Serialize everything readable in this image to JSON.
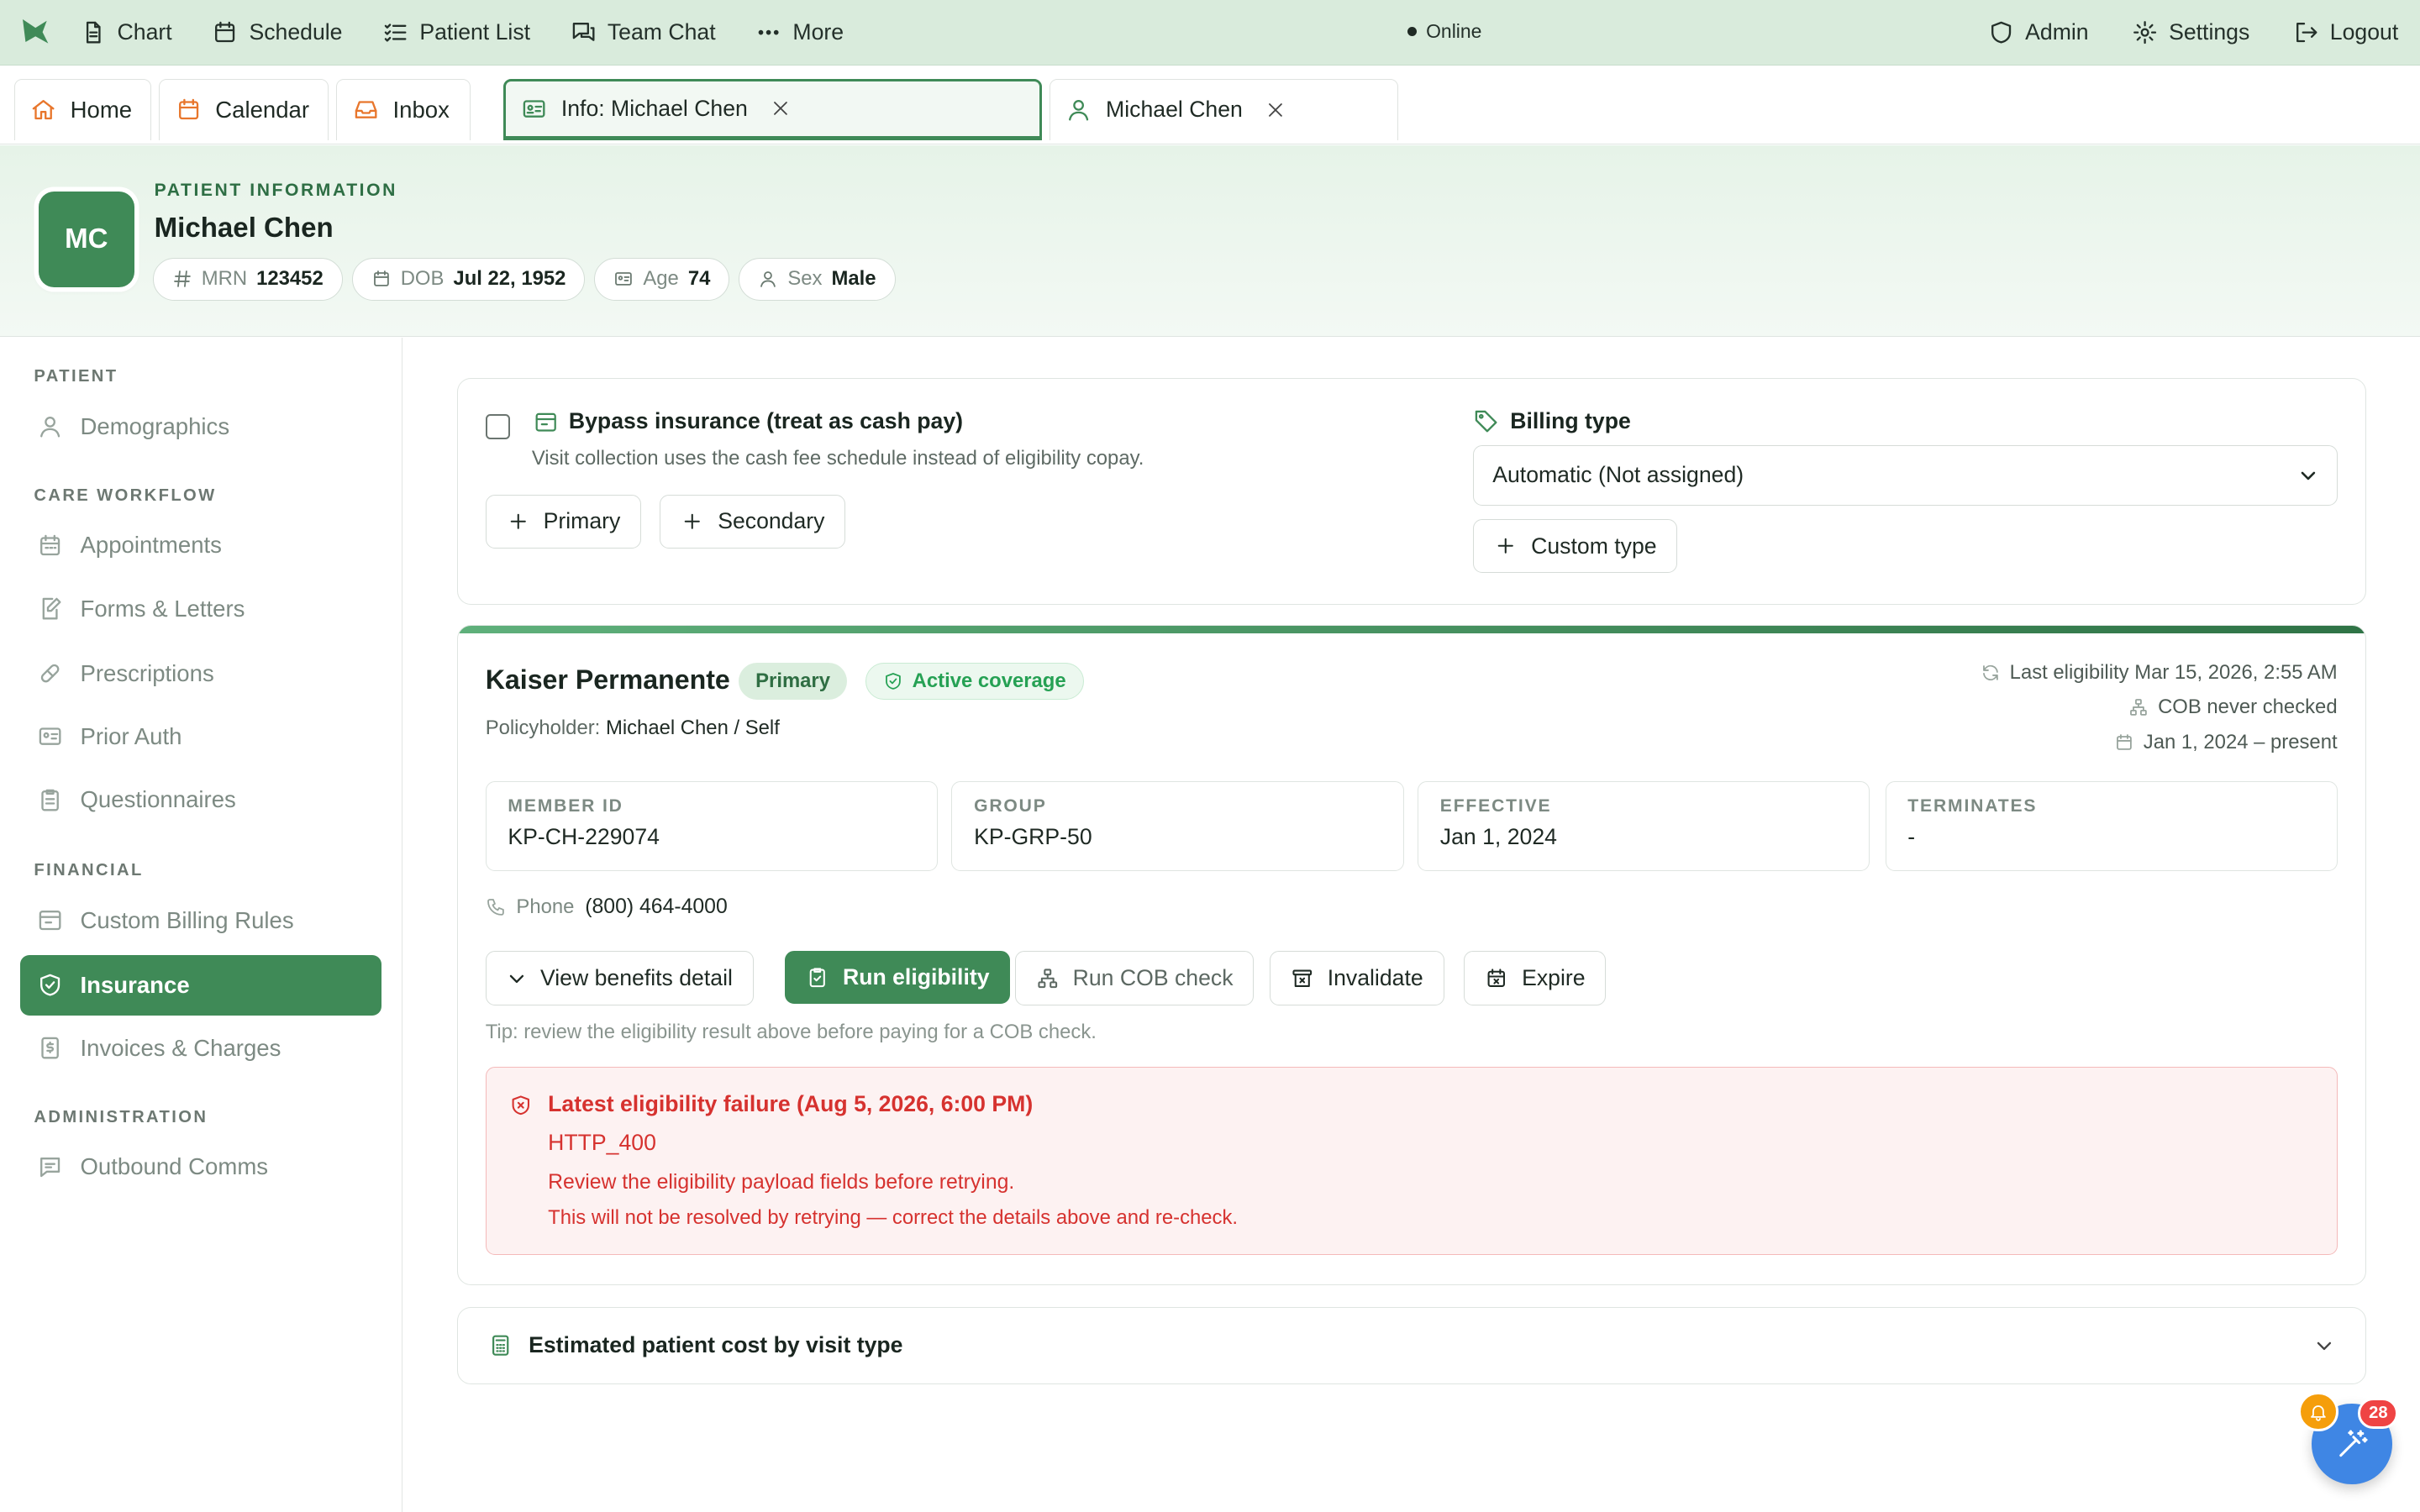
{
  "topnav": {
    "items": [
      {
        "label": "Chart",
        "icon": "document-icon"
      },
      {
        "label": "Schedule",
        "icon": "calendar-icon"
      },
      {
        "label": "Patient List",
        "icon": "list-check-icon"
      },
      {
        "label": "Team Chat",
        "icon": "chat-icon"
      },
      {
        "label": "More",
        "icon": "ellipsis-icon"
      }
    ],
    "status": "Online",
    "right": [
      {
        "label": "Admin",
        "icon": "shield-icon"
      },
      {
        "label": "Settings",
        "icon": "gear-icon"
      },
      {
        "label": "Logout",
        "icon": "logout-icon"
      }
    ]
  },
  "tabs": {
    "home": "Home",
    "calendar": "Calendar",
    "inbox": "Inbox",
    "info": "Info: Michael Chen",
    "patient": "Michael Chen"
  },
  "patient": {
    "section_label": "PATIENT INFORMATION",
    "initials": "MC",
    "name": "Michael Chen",
    "mrn_label": "MRN",
    "mrn": "123452",
    "dob_label": "DOB",
    "dob": "Jul 22, 1952",
    "age_label": "Age",
    "age": "74",
    "sex_label": "Sex",
    "sex": "Male"
  },
  "sidebar": {
    "sections": {
      "patient": "PATIENT",
      "care": "CARE WORKFLOW",
      "financial": "FINANCIAL",
      "admin": "ADMINISTRATION"
    },
    "items": {
      "demographics": "Demographics",
      "appointments": "Appointments",
      "forms": "Forms & Letters",
      "prescriptions": "Prescriptions",
      "prior_auth": "Prior Auth",
      "questionnaires": "Questionnaires",
      "billing_rules": "Custom Billing Rules",
      "insurance": "Insurance",
      "invoices": "Invoices & Charges",
      "outbound": "Outbound Comms"
    },
    "active": "Insurance"
  },
  "bypass": {
    "checked": false,
    "title": "Bypass insurance (treat as cash pay)",
    "subtitle": "Visit collection uses the cash fee schedule instead of eligibility copay.",
    "primary_btn": "Primary",
    "secondary_btn": "Secondary",
    "billing_label": "Billing type",
    "billing_value": "Automatic (Not assigned)",
    "custom_btn": "Custom type"
  },
  "policy": {
    "payer": "Kaiser Permanente",
    "rank_badge": "Primary",
    "coverage_badge": "Active coverage",
    "policyholder_label": "Policyholder:",
    "policyholder": "Michael Chen / Self",
    "last_eligibility": "Last eligibility Mar 15, 2026, 2:55 AM",
    "cob_status": "COB never checked",
    "date_range": "Jan 1, 2024 – present",
    "fields": [
      {
        "label": "MEMBER ID",
        "value": "KP-CH-229074"
      },
      {
        "label": "GROUP",
        "value": "KP-GRP-50"
      },
      {
        "label": "EFFECTIVE",
        "value": "Jan 1, 2024"
      },
      {
        "label": "TERMINATES",
        "value": "-"
      }
    ],
    "phone_label": "Phone",
    "phone": "(800) 464-4000",
    "actions": {
      "benefits": "View benefits detail",
      "run_eligibility": "Run eligibility",
      "cob": "Run COB check",
      "invalidate": "Invalidate",
      "expire": "Expire"
    },
    "tip": "Tip: review the eligibility result above before paying for a COB check.",
    "failure": {
      "title": "Latest eligibility failure (Aug 5, 2026, 6:00 PM)",
      "code": "HTTP_400",
      "message": "Review the eligibility payload fields before retrying.",
      "note": "This will not be resolved by retrying — correct the details above and re-check."
    }
  },
  "estimate": {
    "title": "Estimated patient cost by visit type"
  },
  "notifications": {
    "count": "28"
  },
  "colors": {
    "brand": "#3f8a57",
    "topbar": "#d9ebdc",
    "error": "#d6322f",
    "fab": "#3f86e4"
  }
}
